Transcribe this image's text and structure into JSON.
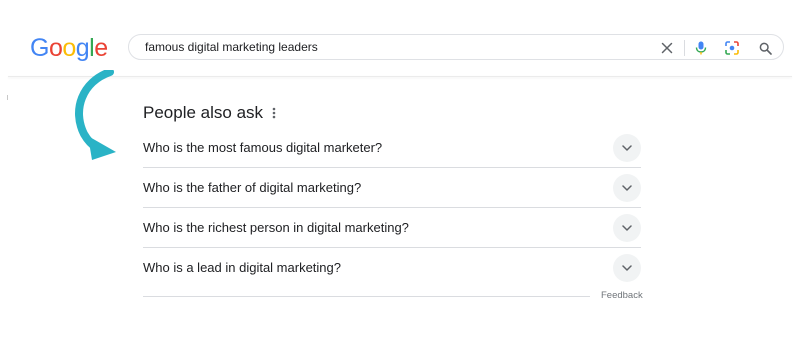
{
  "logo": {
    "letters": [
      {
        "char": "G",
        "color": "#4285F4"
      },
      {
        "char": "o",
        "color": "#EA4335"
      },
      {
        "char": "o",
        "color": "#FBBC05"
      },
      {
        "char": "g",
        "color": "#4285F4"
      },
      {
        "char": "l",
        "color": "#34A853"
      },
      {
        "char": "e",
        "color": "#EA4335"
      }
    ]
  },
  "search": {
    "query": "famous digital marketing leaders",
    "icons": [
      "close-icon",
      "microphone-icon",
      "lens-icon",
      "search-icon"
    ]
  },
  "annotation": {
    "arrow_color": "#2AB3C6",
    "icon": "curved-arrow-icon"
  },
  "people_also_ask": {
    "title": "People also ask",
    "menu_icon": "more-vertical-icon",
    "questions": [
      {
        "text": "Who is the most famous digital marketer?"
      },
      {
        "text": "Who is the father of digital marketing?"
      },
      {
        "text": "Who is the richest person in digital marketing?"
      },
      {
        "text": "Who is a lead in digital marketing?"
      }
    ],
    "feedback_label": "Feedback"
  }
}
